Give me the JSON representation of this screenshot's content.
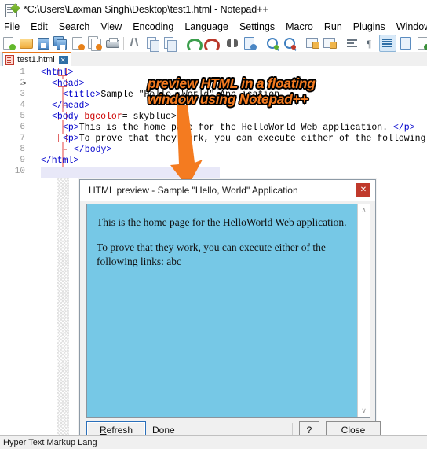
{
  "window": {
    "title": "*C:\\Users\\Laxman Singh\\Desktop\\test1.html - Notepad++",
    "icon": "notepad-plus-plus-icon"
  },
  "menubar": {
    "items": [
      {
        "label": "File"
      },
      {
        "label": "Edit"
      },
      {
        "label": "Search"
      },
      {
        "label": "View"
      },
      {
        "label": "Encoding"
      },
      {
        "label": "Language"
      },
      {
        "label": "Settings"
      },
      {
        "label": "Macro"
      },
      {
        "label": "Run"
      },
      {
        "label": "Plugins"
      },
      {
        "label": "Window"
      },
      {
        "label": "?"
      }
    ]
  },
  "toolbar": {
    "icons": [
      "new-file-icon",
      "open-file-icon",
      "save-icon",
      "save-all-icon",
      "close-file-icon",
      "close-all-icon",
      "print-icon",
      "cut-icon",
      "copy-icon",
      "paste-icon",
      "undo-icon",
      "redo-icon",
      "find-icon",
      "replace-icon",
      "zoom-in-icon",
      "zoom-out-icon",
      "sync-vertical-icon",
      "sync-horizontal-icon",
      "word-wrap-icon",
      "show-all-characters-icon",
      "indent-guide-icon",
      "user-defined-language-icon",
      "show-function-list-icon",
      "document-map-icon",
      "record-macro-icon"
    ]
  },
  "tabs": [
    {
      "label": "test1.html",
      "icon": "html-file-icon",
      "close": "✕",
      "active": true
    }
  ],
  "editor": {
    "line_numbers": [
      "1",
      "2",
      "3",
      "4",
      "5",
      "6",
      "7",
      "8",
      "9",
      "10"
    ],
    "lines": [
      {
        "n": 1,
        "segments": [
          {
            "t": "<html>",
            "c": "tag"
          }
        ],
        "indent": 0
      },
      {
        "n": 2,
        "segments": [
          {
            "t": "<head>",
            "c": "tag"
          }
        ],
        "indent": 2
      },
      {
        "n": 3,
        "segments": [
          {
            "t": "<title>",
            "c": "tag"
          },
          {
            "t": "Sample \"Hello, World\" Application",
            "c": "txt"
          }
        ],
        "indent": 4
      },
      {
        "n": 4,
        "segments": [
          {
            "t": "</head>",
            "c": "tag"
          }
        ],
        "indent": 2
      },
      {
        "n": 5,
        "segments": [
          {
            "t": "<body ",
            "c": "tag"
          },
          {
            "t": "bgcolor",
            "c": "attr"
          },
          {
            "t": "= skyblue>",
            "c": "txt"
          }
        ],
        "indent": 2
      },
      {
        "n": 6,
        "segments": [
          {
            "t": "<p>",
            "c": "tag"
          },
          {
            "t": "This is the home page for the HelloWorld Web application. ",
            "c": "txt"
          },
          {
            "t": "</p>",
            "c": "tag"
          }
        ],
        "indent": 4
      },
      {
        "n": 7,
        "segments": [
          {
            "t": "<p>",
            "c": "tag"
          },
          {
            "t": "To prove that they work, you can execute either of the following",
            "c": "txt"
          }
        ],
        "indent": 4
      },
      {
        "n": 8,
        "segments": [
          {
            "t": "</body>",
            "c": "tag"
          }
        ],
        "indent": 6
      },
      {
        "n": 9,
        "segments": [
          {
            "t": "</html>",
            "c": "tag"
          }
        ],
        "indent": 0
      },
      {
        "n": 10,
        "segments": [],
        "indent": 0
      }
    ]
  },
  "annotation": {
    "line1": "preview HTML in a floating",
    "line2": "window using Notepad++",
    "color": "#F47B20",
    "arrow": "down-arrow-annotation"
  },
  "dialog": {
    "title": "HTML preview - Sample \"Hello, World\" Application",
    "close_label": "✕",
    "background_color": "#76c8e6",
    "preview_paragraphs": [
      "This is the home page for the HelloWorld Web application.",
      "To prove that they work, you can execute either of the following links: abc"
    ],
    "scrollbar": {
      "up": "∧",
      "down": "∨"
    },
    "footer": {
      "refresh_prefix": "R",
      "refresh_rest": "efresh",
      "status": "Done",
      "help_label": "?",
      "close_label": "Close"
    }
  },
  "statusbar": {
    "text": "Hyper Text Markup Lang"
  }
}
